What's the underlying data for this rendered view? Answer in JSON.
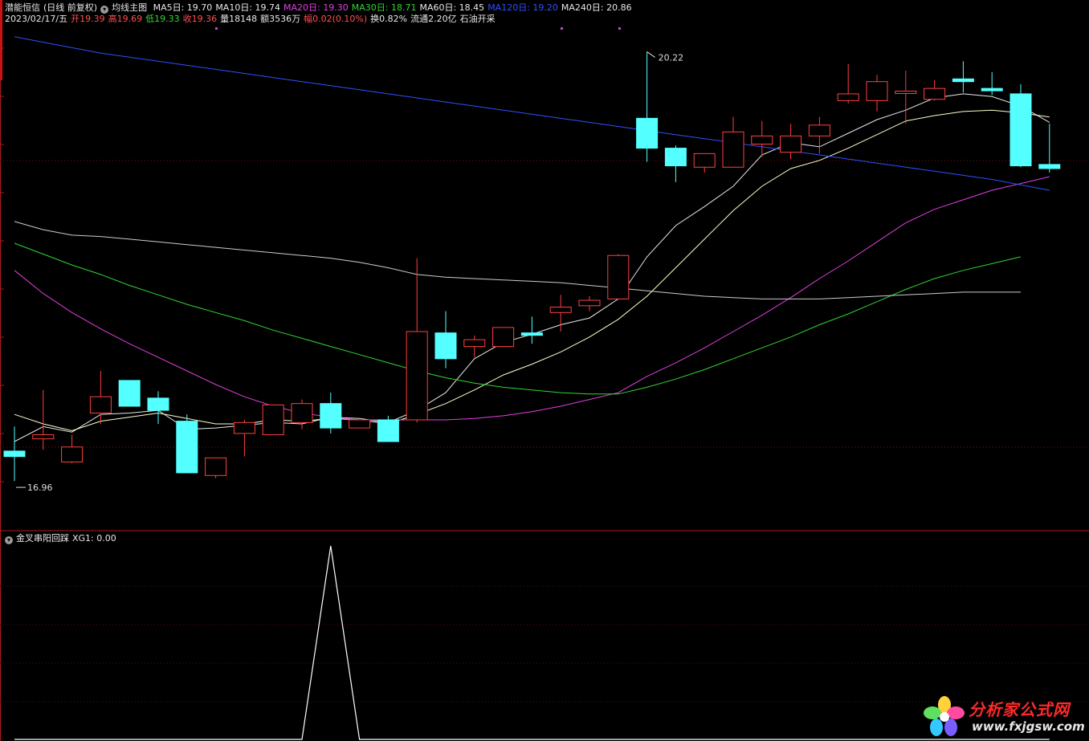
{
  "header": {
    "stock_name": "潜能恒信",
    "mode": "(日线 前复权)",
    "indicator_name": "均线主图",
    "ma_items": [
      {
        "label": "MA5日: 19.70",
        "color": "#e8e8e8"
      },
      {
        "label": "MA10日: 19.74",
        "color": "#e8e8e8"
      },
      {
        "label": "MA20日: 19.30",
        "color": "#e040e0"
      },
      {
        "label": "MA30日: 18.71",
        "color": "#32d732"
      },
      {
        "label": "MA60日: 18.45",
        "color": "#e8e8e8"
      },
      {
        "label": "MA120日: 19.20",
        "color": "#3050ff"
      },
      {
        "label": "MA240日: 20.86",
        "color": "#e8e8e8"
      }
    ],
    "date": "2023/02/17/五",
    "open": "开19.39",
    "high": "高19.69",
    "low": "低19.33",
    "close": "收19.36",
    "volume": "量18148",
    "amount": "额3536万",
    "change": "幅0.02(0.10%)",
    "turnover": "换0.82%",
    "float": "流通2.20亿",
    "sector": "石油开采"
  },
  "sub_panel": {
    "name": "金叉串阳回踩",
    "value": "XG1: 0.00"
  },
  "annotations": {
    "max_label": "20.22",
    "min_label": "16.96"
  },
  "watermark": {
    "brand": "分析家公式网",
    "url": "www.fxjgsw.com"
  },
  "colors": {
    "background": "#000000",
    "up_candle": "#ff4040",
    "down_candle": "#54ffff",
    "panel_border": "#b01c1c",
    "ma5": "#e8e8e8",
    "ma10": "#ffffcc",
    "ma20": "#e040e0",
    "ma30": "#32d732",
    "ma60": "#cccccc",
    "ma120": "#3050ff",
    "xg1": "#ffffff"
  },
  "chart_data": [
    {
      "type": "candlestick",
      "title": "潜能恒信 (日线 前复权)",
      "ylim": [
        16.7,
        20.4
      ],
      "candles": [
        {
          "o": 17.28,
          "h": 17.46,
          "l": 17.06,
          "c": 17.24
        },
        {
          "o": 17.37,
          "h": 17.73,
          "l": 17.29,
          "c": 17.4
        },
        {
          "o": 17.2,
          "h": 17.4,
          "l": 17.19,
          "c": 17.31
        },
        {
          "o": 17.56,
          "h": 17.87,
          "l": 17.48,
          "c": 17.68
        },
        {
          "o": 17.8,
          "h": 17.8,
          "l": 17.63,
          "c": 17.61
        },
        {
          "o": 17.67,
          "h": 17.72,
          "l": 17.48,
          "c": 17.58
        },
        {
          "o": 17.5,
          "h": 17.55,
          "l": 17.12,
          "c": 17.12
        },
        {
          "o": 17.1,
          "h": 17.23,
          "l": 17.08,
          "c": 17.23
        },
        {
          "o": 17.41,
          "h": 17.51,
          "l": 17.24,
          "c": 17.49
        },
        {
          "o": 17.4,
          "h": 17.61,
          "l": 17.4,
          "c": 17.62
        },
        {
          "o": 17.49,
          "h": 17.66,
          "l": 17.44,
          "c": 17.63
        },
        {
          "o": 17.63,
          "h": 17.71,
          "l": 17.41,
          "c": 17.45
        },
        {
          "o": 17.45,
          "h": 17.49,
          "l": 17.48,
          "c": 17.51
        },
        {
          "o": 17.51,
          "h": 17.54,
          "l": 17.35,
          "c": 17.35
        },
        {
          "o": 17.51,
          "h": 18.7,
          "l": 17.49,
          "c": 18.16
        },
        {
          "o": 18.15,
          "h": 18.31,
          "l": 17.89,
          "c": 17.96
        },
        {
          "o": 18.05,
          "h": 18.13,
          "l": 17.97,
          "c": 18.1
        },
        {
          "o": 18.05,
          "h": 18.17,
          "l": 18.05,
          "c": 18.19
        },
        {
          "o": 18.15,
          "h": 18.27,
          "l": 18.07,
          "c": 18.14
        },
        {
          "o": 18.3,
          "h": 18.43,
          "l": 18.16,
          "c": 18.34
        },
        {
          "o": 18.35,
          "h": 18.42,
          "l": 18.31,
          "c": 18.39
        },
        {
          "o": 18.4,
          "h": 18.73,
          "l": 18.4,
          "c": 18.72
        },
        {
          "o": 19.73,
          "h": 20.22,
          "l": 19.41,
          "c": 19.51
        },
        {
          "o": 19.51,
          "h": 19.53,
          "l": 19.26,
          "c": 19.38
        },
        {
          "o": 19.37,
          "h": 19.47,
          "l": 19.33,
          "c": 19.47
        },
        {
          "o": 19.37,
          "h": 19.74,
          "l": 19.37,
          "c": 19.63
        },
        {
          "o": 19.54,
          "h": 19.71,
          "l": 19.45,
          "c": 19.6
        },
        {
          "o": 19.48,
          "h": 19.69,
          "l": 19.43,
          "c": 19.6
        },
        {
          "o": 19.6,
          "h": 19.74,
          "l": 19.47,
          "c": 19.68
        },
        {
          "o": 19.86,
          "h": 20.13,
          "l": 19.84,
          "c": 19.91
        },
        {
          "o": 19.86,
          "h": 20.05,
          "l": 19.78,
          "c": 20.0
        },
        {
          "o": 19.93,
          "h": 20.08,
          "l": 19.69,
          "c": 19.93
        },
        {
          "o": 19.87,
          "h": 20.01,
          "l": 19.86,
          "c": 19.95
        },
        {
          "o": 20.02,
          "h": 20.15,
          "l": 19.92,
          "c": 20.0
        },
        {
          "o": 19.95,
          "h": 20.07,
          "l": 19.9,
          "c": 19.94
        },
        {
          "o": 19.91,
          "h": 19.98,
          "l": 19.37,
          "c": 19.38
        },
        {
          "o": 19.39,
          "h": 19.69,
          "l": 19.33,
          "c": 19.36
        }
      ],
      "ma": {
        "ma5": [
          17.35,
          17.46,
          17.42,
          17.55,
          17.56,
          17.58,
          17.44,
          17.45,
          17.47,
          17.49,
          17.48,
          17.53,
          17.52,
          17.49,
          17.58,
          17.71,
          17.96,
          18.08,
          18.14,
          18.21,
          18.26,
          18.4,
          18.71,
          18.94,
          19.08,
          19.23,
          19.46,
          19.55,
          19.52,
          19.62,
          19.72,
          19.79,
          19.88,
          19.91,
          19.89,
          19.82,
          19.7
        ],
        "ma10": [
          17.55,
          17.48,
          17.43,
          17.5,
          17.53,
          17.56,
          17.52,
          17.48,
          17.48,
          17.51,
          17.5,
          17.52,
          17.51,
          17.48,
          17.55,
          17.63,
          17.73,
          17.84,
          17.92,
          18.01,
          18.12,
          18.25,
          18.42,
          18.63,
          18.84,
          19.05,
          19.23,
          19.36,
          19.42,
          19.51,
          19.61,
          19.71,
          19.75,
          19.78,
          19.79,
          19.77,
          19.74
        ],
        "ma20": [
          18.61,
          18.44,
          18.3,
          18.18,
          18.07,
          17.97,
          17.87,
          17.77,
          17.68,
          17.61,
          17.56,
          17.53,
          17.51,
          17.51,
          17.51,
          17.51,
          17.52,
          17.54,
          17.57,
          17.61,
          17.66,
          17.71,
          17.83,
          17.93,
          18.04,
          18.16,
          18.28,
          18.41,
          18.55,
          18.68,
          18.82,
          18.96,
          19.06,
          19.13,
          19.2,
          19.25,
          19.3
        ],
        "ma30": [
          18.81,
          18.73,
          18.65,
          18.58,
          18.5,
          18.43,
          18.36,
          18.3,
          18.24,
          18.17,
          18.11,
          18.05,
          17.99,
          17.93,
          17.87,
          17.82,
          17.78,
          17.75,
          17.73,
          17.71,
          17.7,
          17.7,
          17.75,
          17.81,
          17.88,
          17.96,
          18.04,
          18.12,
          18.21,
          18.29,
          18.38,
          18.47,
          18.55,
          18.61,
          18.66,
          18.71
        ],
        "ma60": [
          18.97,
          18.91,
          18.87,
          18.86,
          18.84,
          18.82,
          18.8,
          18.78,
          18.76,
          18.74,
          18.72,
          18.7,
          18.67,
          18.63,
          18.58,
          18.56,
          18.55,
          18.54,
          18.53,
          18.52,
          18.5,
          18.48,
          18.46,
          18.44,
          18.42,
          18.41,
          18.4,
          18.4,
          18.4,
          18.41,
          18.42,
          18.43,
          18.44,
          18.45,
          18.45,
          18.45
        ],
        "ma120": [
          20.33,
          20.29,
          20.25,
          20.21,
          20.18,
          20.15,
          20.12,
          20.09,
          20.06,
          20.03,
          20.0,
          19.97,
          19.94,
          19.91,
          19.88,
          19.85,
          19.82,
          19.79,
          19.76,
          19.73,
          19.7,
          19.67,
          19.64,
          19.61,
          19.58,
          19.55,
          19.52,
          19.49,
          19.46,
          19.43,
          19.4,
          19.37,
          19.34,
          19.31,
          19.28,
          19.24,
          19.2
        ]
      }
    },
    {
      "type": "line",
      "title": "金叉串阳回踩",
      "series": [
        {
          "name": "XG1",
          "values": [
            0,
            0,
            0,
            0,
            0,
            0,
            0,
            0,
            0,
            0,
            0,
            1,
            0,
            0,
            0,
            0,
            0,
            0,
            0,
            0,
            0,
            0,
            0,
            0,
            0,
            0,
            0,
            0,
            0,
            0,
            0,
            0,
            0,
            0,
            0,
            0,
            0
          ]
        }
      ],
      "ylim": [
        0,
        1
      ]
    }
  ]
}
